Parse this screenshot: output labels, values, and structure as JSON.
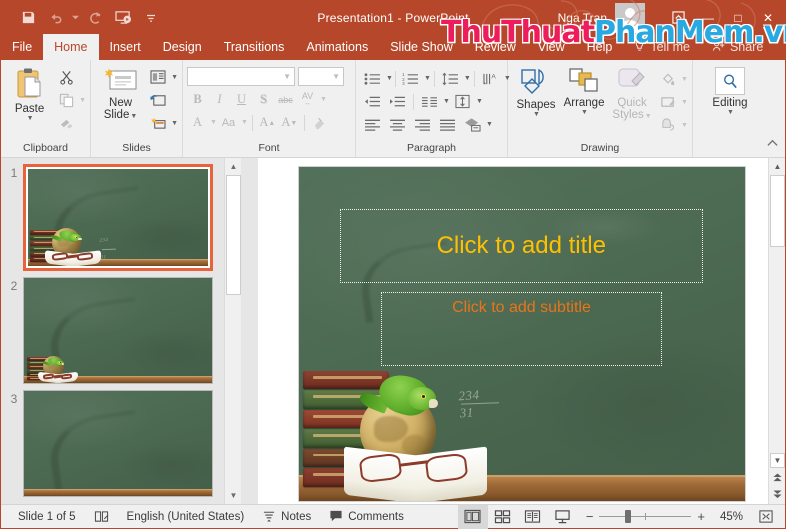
{
  "titlebar": {
    "title": "Presentation1  -  PowerPoint",
    "account_name": "Nga Tran",
    "qat": [
      {
        "name": "save-icon",
        "label": "Save"
      },
      {
        "name": "undo-icon",
        "label": "Undo"
      },
      {
        "name": "redo-icon",
        "label": "Redo"
      },
      {
        "name": "start-from-beginning-icon",
        "label": "Start From Beginning"
      },
      {
        "name": "customize-qat-icon",
        "label": "Customize Quick Access Toolbar"
      }
    ],
    "window_buttons": {
      "ribbon_display": "⬜",
      "minimize": "—",
      "restore": "□",
      "close": "✕"
    }
  },
  "tabs": [
    {
      "label": "File",
      "active": false
    },
    {
      "label": "Home",
      "active": true
    },
    {
      "label": "Insert",
      "active": false
    },
    {
      "label": "Design",
      "active": false
    },
    {
      "label": "Transitions",
      "active": false
    },
    {
      "label": "Animations",
      "active": false
    },
    {
      "label": "Slide Show",
      "active": false
    },
    {
      "label": "Review",
      "active": false
    },
    {
      "label": "View",
      "active": false
    },
    {
      "label": "Help",
      "active": false
    },
    {
      "label": "Tell me",
      "active": false
    },
    {
      "label": "Share",
      "active": false
    }
  ],
  "ribbon": {
    "groups": [
      {
        "label": "Clipboard"
      },
      {
        "label": "Slides"
      },
      {
        "label": "Font"
      },
      {
        "label": "Paragraph"
      },
      {
        "label": "Drawing"
      },
      {
        "label": ""
      }
    ],
    "clipboard": {
      "paste_label": "Paste",
      "cut_label": "Cut",
      "copy_label": "Copy",
      "format_painter_label": "Format Painter"
    },
    "slides": {
      "new_slide_label": "New\nSlide",
      "new_slide_line1": "New",
      "new_slide_line2": "Slide",
      "layout_label": "Layout",
      "reset_label": "Reset",
      "section_label": "Section"
    },
    "font": {
      "font_name_value": "",
      "font_size_value": "",
      "bold": "B",
      "italic": "I",
      "underline": "U",
      "shadow": "S",
      "strikethrough": "abc",
      "character_spacing": "AV",
      "font_color": "A",
      "change_case": "Aa",
      "increase_size": "A",
      "decrease_size": "A",
      "clear_formatting_label": "Clear All Formatting"
    },
    "paragraph": {
      "bullets_label": "Bullets",
      "numbering_label": "Numbering",
      "decrease_indent_label": "Decrease List Level",
      "increase_indent_label": "Increase List Level",
      "line_spacing_label": "Line Spacing",
      "text_direction_label": "Text Direction",
      "align_text_label": "Align Text",
      "convert_smartart_label": "Convert to SmartArt",
      "align_left_label": "Align Left",
      "align_center_label": "Center",
      "align_right_label": "Align Right",
      "justify_label": "Justify",
      "columns_label": "Columns"
    },
    "drawing": {
      "shapes_label": "Shapes",
      "arrange_label": "Arrange",
      "quick_styles_line1": "Quick",
      "quick_styles_line2": "Styles",
      "shape_fill_label": "Shape Fill",
      "shape_outline_label": "Shape Outline",
      "shape_effects_label": "Shape Effects"
    },
    "editing": {
      "editing_label": "Editing"
    },
    "collapse_ribbon_label": "Collapse the Ribbon"
  },
  "slides_panel": {
    "slides": [
      {
        "number": "1",
        "selected": true,
        "has_text": true
      },
      {
        "number": "2",
        "selected": false,
        "has_text": false
      },
      {
        "number": "3",
        "selected": false,
        "has_text": false
      }
    ]
  },
  "slide": {
    "title_placeholder": "Click to add title",
    "subtitle_placeholder": "Click to add subtitle",
    "title_color": "#ffc000",
    "subtitle_color": "#e8751a",
    "board_color": "#4a6b4d",
    "chalk_numerator": "234",
    "chalk_denominator": "31"
  },
  "status": {
    "slide_count_text": "Slide 1 of 5",
    "language": "English (United States)",
    "notes_label": "Notes",
    "comments_label": "Comments",
    "zoom_percent": "45%",
    "views": [
      {
        "name": "normal-view",
        "active": true
      },
      {
        "name": "slide-sorter-view",
        "active": false
      },
      {
        "name": "reading-view",
        "active": false
      },
      {
        "name": "slide-show-view",
        "active": false
      }
    ],
    "zoom_out_label": "−",
    "zoom_in_label": "+",
    "fit_slide_label": "Fit slide to current window"
  },
  "watermark": {
    "part1": "ThuThuat",
    "part2": "PhanMem.vn",
    "color1": "#ed1c5b",
    "color2": "#29a9e1"
  }
}
